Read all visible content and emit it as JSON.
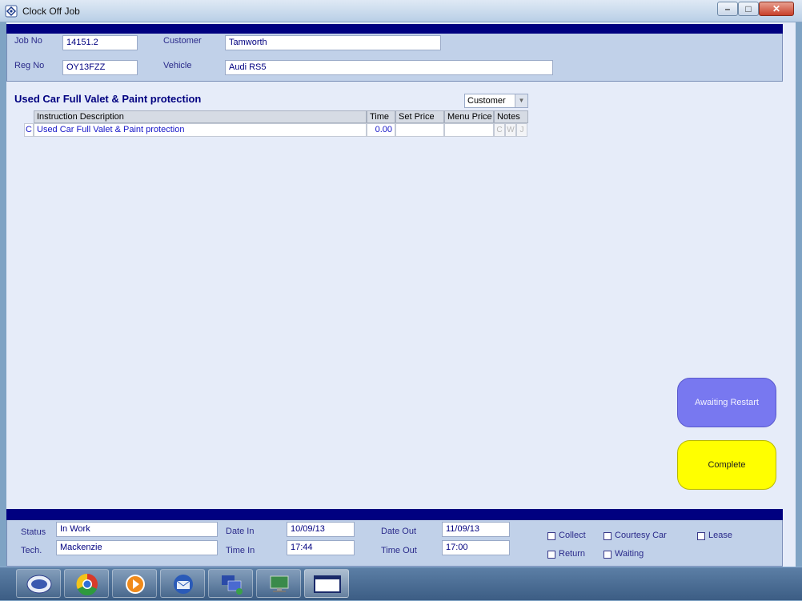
{
  "window": {
    "title": "Clock Off Job"
  },
  "header": {
    "job_no_label": "Job No",
    "job_no": "14151.2",
    "customer_label": "Customer",
    "customer": "Tamworth",
    "reg_no_label": "Reg No",
    "reg_no": "OY13FZZ",
    "vehicle_label": "Vehicle",
    "vehicle": "Audi RS5"
  },
  "job_title": "Used Car Full Valet & Paint protection",
  "customer_select": {
    "value": "Customer"
  },
  "grid": {
    "columns": [
      "Instruction Description",
      "Time",
      "Set Price",
      "Menu Price",
      "Notes"
    ],
    "rows": [
      {
        "type": "C",
        "description": "Used Car Full Valet & Paint protection",
        "time": "0.00",
        "set_price": "",
        "menu_price": "",
        "notes": [
          "C",
          "W",
          "J"
        ]
      }
    ]
  },
  "buttons": {
    "awaiting_restart": "Awaiting Restart",
    "complete": "Complete"
  },
  "footer": {
    "status_label": "Status",
    "status": "In Work",
    "tech_label": "Tech.",
    "tech": "Mackenzie",
    "date_in_label": "Date In",
    "date_in": "10/09/13",
    "time_in_label": "Time In",
    "time_in": "17:44",
    "date_out_label": "Date Out",
    "date_out": "11/09/13",
    "time_out_label": "Time Out",
    "time_out": "17:00",
    "checkboxes": [
      {
        "label": "Collect",
        "checked": false
      },
      {
        "label": "Courtesy Car",
        "checked": false
      },
      {
        "label": "Lease",
        "checked": false
      },
      {
        "label": "Return",
        "checked": false
      },
      {
        "label": "Waiting",
        "checked": false
      }
    ]
  },
  "taskbar": {
    "apps": [
      "cars-app-icon",
      "chrome-icon",
      "media-player-icon",
      "thunderbird-icon",
      "network-icon",
      "remote-desktop-icon",
      "window-icon"
    ]
  }
}
